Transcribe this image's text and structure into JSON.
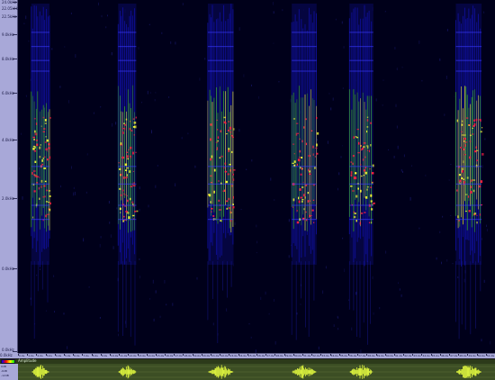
{
  "frequency_axis": {
    "labels": [
      {
        "text": "24.0kHz",
        "pos": 0.005
      },
      {
        "text": "22.05kHz",
        "pos": 0.022
      },
      {
        "text": "22.5kHz",
        "pos": 0.045
      },
      {
        "text": "9.0kHz",
        "pos": 0.097
      },
      {
        "text": "8.0kHz",
        "pos": 0.167
      },
      {
        "text": "6.0kHz",
        "pos": 0.263
      },
      {
        "text": "4.0kHz",
        "pos": 0.395
      },
      {
        "text": "2.0kHz",
        "pos": 0.56
      },
      {
        "text": "0.0kHz",
        "pos": 0.76
      },
      {
        "text": "0.0kHz",
        "pos": 0.995
      }
    ]
  },
  "time_axis": {
    "labels": [
      "0.0s",
      "1.0s",
      "2.0s",
      "3.0s",
      "4.0s",
      "5.0s",
      "6.0s",
      "7.0s",
      "8.0s",
      "9.0s",
      "10.0s",
      "11.0s",
      "12.0s",
      "13.0s",
      "14.0s",
      "15.0s",
      "16.0s",
      "17.0s",
      "18.0s",
      "19.0s",
      "20.0s",
      "21.0s",
      "22.0s",
      "23.0s",
      "24.0s",
      "25.0s",
      "26.0s",
      "27.0s",
      "28.0s",
      "29.0s",
      "30.0s",
      "31.0s",
      "32.0s",
      "33.0s",
      "34.0s",
      "35.0s",
      "36.0s",
      "37.0s",
      "38.0s",
      "39.0s",
      "40.0s",
      "41.0s",
      "42.0s",
      "43.0s",
      "44.0s",
      "45.0s",
      "46.0s",
      "47.0s",
      "48.0s",
      "49.0s",
      "50.0s",
      "51.0s"
    ],
    "corner_label": "0.0kHz"
  },
  "waveform_panel": {
    "label": "Amplitude",
    "axis_labels": [
      "0dB",
      "-6dB",
      "-12dB"
    ]
  },
  "bursts": [
    {
      "start": 0.028,
      "end": 0.066
    },
    {
      "start": 0.21,
      "end": 0.248
    },
    {
      "start": 0.398,
      "end": 0.452
    },
    {
      "start": 0.574,
      "end": 0.626
    },
    {
      "start": 0.695,
      "end": 0.745
    },
    {
      "start": 0.918,
      "end": 0.972
    }
  ],
  "colors": {
    "background": "#00001a",
    "ruler": "#a8a8d8",
    "waveform_bg": "#3c4e24",
    "waveform_line": "#e8ff40",
    "spec_low": "#1010a0",
    "spec_mid": "#40c020",
    "spec_high": "#ff2040",
    "spec_peak": "#ffff30"
  }
}
